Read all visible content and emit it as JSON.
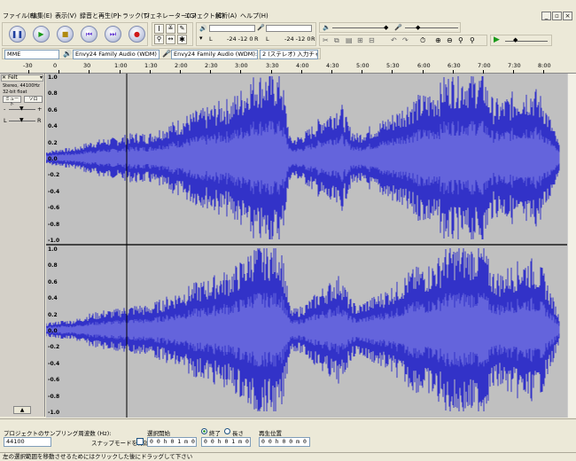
{
  "menu": [
    "ファイル(F)",
    "編集(E)",
    "表示(V)",
    "録音と再生(P)",
    "トラック(T)",
    "ジェネレーター(G)",
    "エフェクト(C)",
    "解析(A)",
    "ヘルプ(H)"
  ],
  "window_controls": [
    "_",
    "▫",
    "×"
  ],
  "transport": {
    "pause": "❚❚",
    "play": "▶",
    "stop": "■",
    "skip_start": "⏮",
    "skip_end": "⏭",
    "record": "●"
  },
  "meters": {
    "labels_left": "-24 -12 0",
    "labels_right": "-24 -12 0",
    "l": "L",
    "r": "R"
  },
  "devices": {
    "host": "MME",
    "output": "Envy24 Family Audio (WDM)",
    "input": "Envy24 Family Audio (WDM): In",
    "channels": "2 (ステレオ) 入力チャ"
  },
  "ruler": {
    "labels": [
      "-30",
      "0",
      "30",
      "1:00",
      "1:30",
      "2:00",
      "2:30",
      "3:00",
      "3:30",
      "4:00",
      "4:30",
      "5:00",
      "5:30",
      "6:00",
      "6:30",
      "7:00",
      "7:30",
      "8:00"
    ]
  },
  "track": {
    "name": "Felt",
    "info1": "Stereo, 44100Hz",
    "info2": "32-bit float",
    "mute": "ミュート",
    "solo": "ソロ",
    "minus": "-",
    "plus": "+",
    "l": "L",
    "r": "R",
    "collapse": "▲"
  },
  "yaxis": [
    "1.0",
    "0.8",
    "0.6",
    "0.4",
    "0.2",
    "0.0",
    "-0.2",
    "-0.4",
    "-0.6",
    "-0.8",
    "-1.0"
  ],
  "bottom": {
    "rate_label": "プロジェクトのサンプリング周波数 (Hz):",
    "rate_value": "44100",
    "snap_label": "スナップモードを有効",
    "sel_start_label": "選択開始",
    "end_label": "終了",
    "length_label": "長さ",
    "sel_start": "0 0 h 0 1 m 0 5 s",
    "sel_end": "0 0 h 0 1 m 0 5 s",
    "play_pos_label": "再生位置",
    "play_pos": "0 0 h 0 0 m 0 0 s"
  },
  "status": "左の選択範囲を移動させるためにはクリックした後にドラッグして下さい",
  "colors": {
    "waveform": "#3232c8",
    "waveform_rms": "#6464dc",
    "background": "#c0c0c0",
    "record": "#d01818",
    "play": "#1a9a1a"
  },
  "waveform_envelope": [
    0.08,
    0.1,
    0.12,
    0.12,
    0.15,
    0.2,
    0.22,
    0.25,
    0.25,
    0.28,
    0.3,
    0.32,
    0.3,
    0.35,
    0.4,
    0.45,
    0.5,
    0.55,
    0.6,
    0.62,
    0.68,
    0.72,
    0.75,
    0.85,
    0.95,
    1.0,
    1.0,
    1.0,
    1.0,
    0.25,
    0.28,
    0.35,
    0.45,
    0.55,
    0.62,
    0.7,
    0.4,
    0.3,
    0.38,
    0.42,
    0.48,
    0.55,
    0.62,
    0.72,
    0.78,
    0.8,
    0.85,
    0.95,
    1.0,
    1.0,
    1.0,
    1.0,
    1.0,
    0.75,
    0.72,
    0.8,
    0.85,
    0.9,
    0.88,
    0.75,
    0.45,
    0.15
  ]
}
